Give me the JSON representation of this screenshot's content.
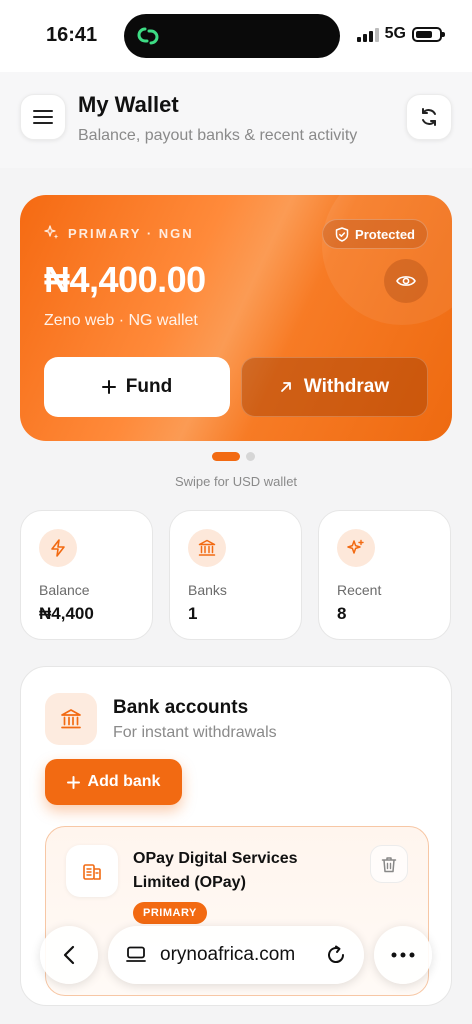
{
  "status": {
    "time": "16:41",
    "network": "5G"
  },
  "header": {
    "title": "My Wallet",
    "subtitle": "Balance, payout banks & recent activity"
  },
  "wallet": {
    "tag": "PRIMARY · NGN",
    "protected_label": "Protected",
    "amount": "₦4,400.00",
    "subtitle": "Zeno web · NG wallet",
    "fund_label": "Fund",
    "withdraw_label": "Withdraw",
    "swipe_hint": "Swipe for USD wallet"
  },
  "stats": [
    {
      "label": "Balance",
      "value": "₦4,400",
      "icon": "bolt-icon"
    },
    {
      "label": "Banks",
      "value": "1",
      "icon": "bank-icon"
    },
    {
      "label": "Recent",
      "value": "8",
      "icon": "sparkle-icon"
    }
  ],
  "bank_accounts": {
    "title": "Bank accounts",
    "subtitle": "For instant withdrawals",
    "add_label": "Add bank",
    "items": [
      {
        "name": "OPay Digital Services Limited (OPay)",
        "badge": "PRIMARY"
      }
    ]
  },
  "browser": {
    "url": "orynoafrica.com"
  },
  "colors": {
    "accent": "#f26a12",
    "accent_light": "#fde8da"
  }
}
